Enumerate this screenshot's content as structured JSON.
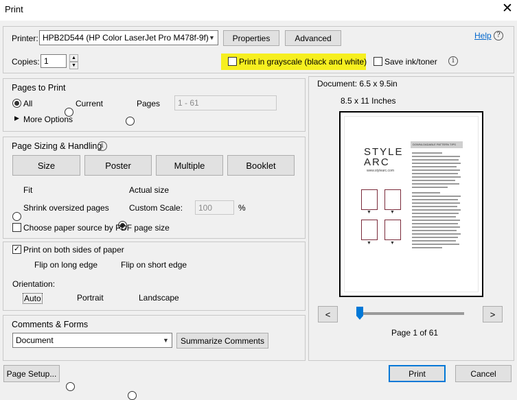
{
  "window": {
    "title": "Print"
  },
  "printer": {
    "label": "Printer:",
    "selected": "HPB2D544 (HP Color LaserJet Pro M478f-9f)",
    "properties_label": "Properties",
    "advanced_label": "Advanced",
    "help_label": "Help"
  },
  "copies": {
    "label": "Copies:",
    "value": "1"
  },
  "grayscale": {
    "label": "Print in grayscale (black and white)",
    "checked": false,
    "highlight_color": "#f6ef1f"
  },
  "save_ink": {
    "label": "Save ink/toner",
    "checked": false
  },
  "pages_to_print": {
    "title": "Pages to Print",
    "options": [
      "All",
      "Current",
      "Pages"
    ],
    "selected": "All",
    "range_value": "1 - 61",
    "more_options": "More Options"
  },
  "sizing": {
    "title": "Page Sizing & Handling",
    "tabs": [
      "Size",
      "Poster",
      "Multiple",
      "Booklet"
    ],
    "active_tab": "Size",
    "fit_label": "Fit",
    "actual_label": "Actual size",
    "shrink_label": "Shrink oversized pages",
    "custom_label": "Custom Scale:",
    "custom_value": "100",
    "percent": "%",
    "selected": "Actual size",
    "paper_source_label": "Choose paper source by PDF page size"
  },
  "duplex": {
    "both_sides_label": "Print on both sides of paper",
    "both_sides_checked": true,
    "long_edge_label": "Flip on long edge",
    "short_edge_label": "Flip on short edge",
    "selected": "Flip on long edge"
  },
  "orientation": {
    "label": "Orientation:",
    "options": [
      "Auto",
      "Portrait",
      "Landscape"
    ],
    "selected": "Auto"
  },
  "comments": {
    "title": "Comments & Forms",
    "selected": "Document",
    "summarize_label": "Summarize Comments"
  },
  "preview": {
    "document_size": "Document: 6.5 x 9.5in",
    "paper_size": "8.5 x 11 Inches",
    "page_status": "Page 1 of 61",
    "prev_label": "<",
    "next_label": ">",
    "slider_fraction": 0,
    "brand_line1": "STYLE",
    "brand_line2": "ARC",
    "brand_url": "www.stylearc.com",
    "heading": "DOWNLOADABLE PATTERN TIPS"
  },
  "footer": {
    "page_setup_label": "Page Setup...",
    "print_label": "Print",
    "cancel_label": "Cancel"
  }
}
